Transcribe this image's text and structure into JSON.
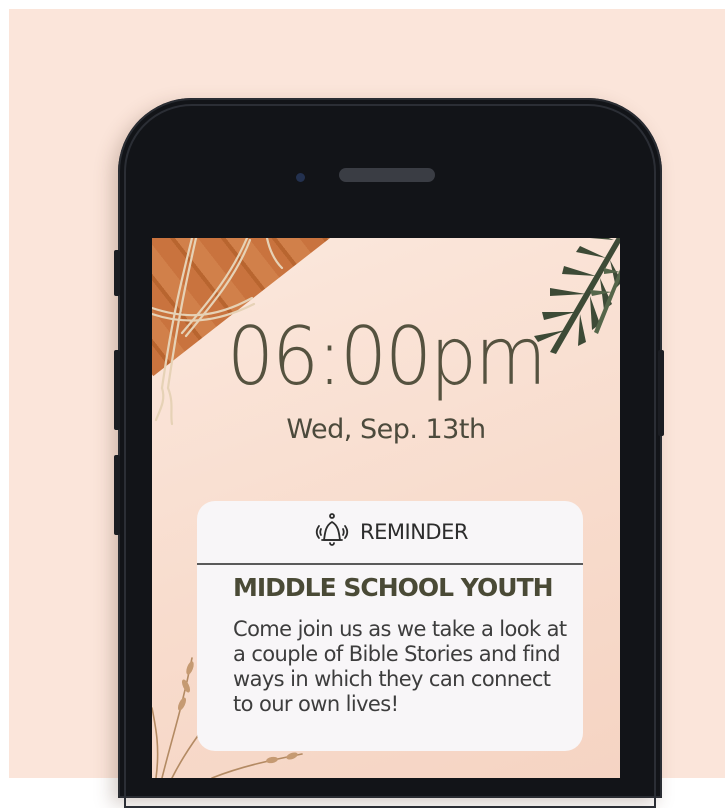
{
  "lockscreen": {
    "time": "06:00pm",
    "date": "Wed, Sep. 13th"
  },
  "notification": {
    "header_icon": "bell-icon",
    "header_label": "REMINDER",
    "title": "MIDDLE SCHOOL YOUTH",
    "body": "Come join us as we take a look at a couple of Bible Stories and find ways in which they can connect to our own lives!"
  },
  "colors": {
    "background": "#fbe5da",
    "phone_body": "#121418",
    "time_text": "#55523f",
    "card_background": "#f8f6f8",
    "title_text": "#4a4a36"
  }
}
